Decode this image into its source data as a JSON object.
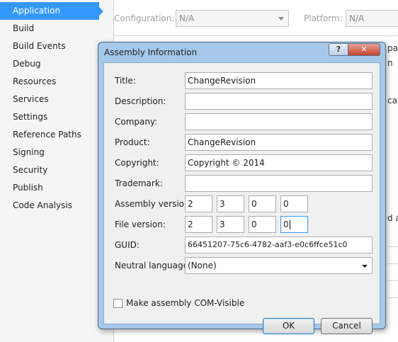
{
  "sidebar": {
    "items": [
      {
        "label": "Application",
        "active": true
      },
      {
        "label": "Build"
      },
      {
        "label": "Build Events"
      },
      {
        "label": "Debug"
      },
      {
        "label": "Resources"
      },
      {
        "label": "Services"
      },
      {
        "label": "Settings"
      },
      {
        "label": "Reference Paths"
      },
      {
        "label": "Signing"
      },
      {
        "label": "Security"
      },
      {
        "label": "Publish"
      },
      {
        "label": "Code Analysis"
      }
    ]
  },
  "background": {
    "configuration_label": "Configuration:",
    "configuration_value": "N/A",
    "platform_label": "Platform:",
    "platform_value": "N/A",
    "frag_1": "pac",
    "frag_2": "n",
    "frag_3": "cati",
    "frag_4": "d a"
  },
  "dialog": {
    "title": "Assembly Information",
    "help_glyph": "?",
    "close_glyph": "✕",
    "fields": {
      "title_label": "Title:",
      "title_value": "ChangeRevision",
      "description_label": "Description:",
      "description_value": "",
      "company_label": "Company:",
      "company_value": "",
      "product_label": "Product:",
      "product_value": "ChangeRevision",
      "copyright_label": "Copyright:",
      "copyright_value": "Copyright ©  2014",
      "trademark_label": "Trademark:",
      "trademark_value": "",
      "assembly_version_label": "Assembly version:",
      "assembly_version": [
        "2",
        "3",
        "0",
        "0"
      ],
      "file_version_label": "File version:",
      "file_version": [
        "2",
        "3",
        "0",
        "0"
      ],
      "guid_label": "GUID:",
      "guid_value": "66451207-75c6-4782-aaf3-e0c6ffce51c0",
      "neutral_language_label": "Neutral language:",
      "neutral_language_value": "(None)",
      "com_visible_label": "Make assembly COM-Visible",
      "com_visible_checked": false
    },
    "ok_label": "OK",
    "cancel_label": "Cancel"
  },
  "colors": {
    "accent": "#3399ff",
    "dialog_frame": "#a6c8ea",
    "close_button": "#c7442e"
  }
}
